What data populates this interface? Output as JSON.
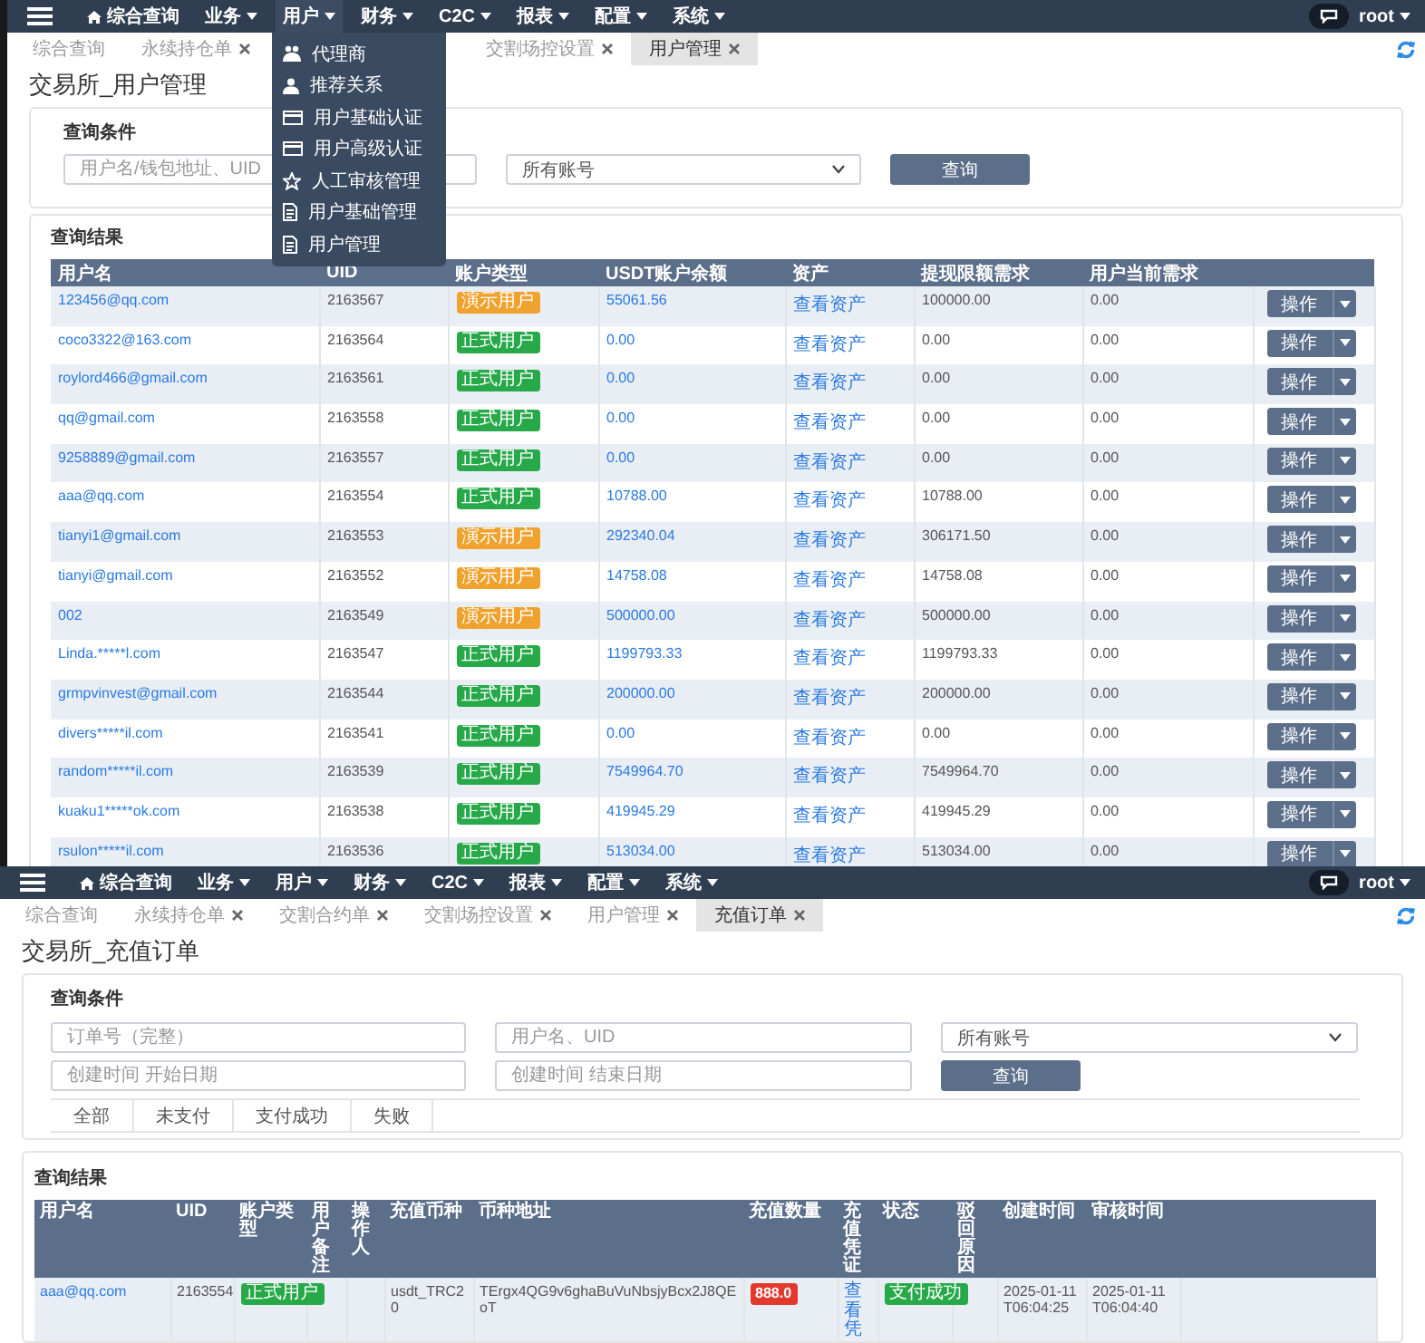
{
  "top_screen": {
    "navbar": {
      "menus": [
        {
          "kind": "home",
          "label": "综合查询"
        },
        {
          "kind": "dropdown",
          "label": "业务",
          "open": false
        },
        {
          "kind": "dropdown",
          "label": "用户",
          "open": true,
          "items": [
            "代理商",
            "推荐关系",
            "用户基础认证",
            "用户高级认证",
            "人工审核管理",
            "用户基础管理",
            "用户管理"
          ]
        },
        {
          "kind": "dropdown",
          "label": "财务",
          "open": false
        },
        {
          "kind": "dropdown",
          "label": "C2C",
          "open": false
        },
        {
          "kind": "dropdown",
          "label": "报表",
          "open": false
        },
        {
          "kind": "dropdown",
          "label": "配置",
          "open": false
        },
        {
          "kind": "dropdown",
          "label": "系统",
          "open": false
        }
      ],
      "user": "root"
    },
    "tabs": [
      {
        "label": "综合查询",
        "closable": false,
        "selected": false
      },
      {
        "label": "永续持仓单",
        "closable": true,
        "selected": false
      },
      {
        "label": "交割场控设置",
        "closable": true,
        "selected": false
      },
      {
        "label": "用户管理",
        "closable": true,
        "selected": true
      }
    ],
    "page_title": "交易所_用户管理",
    "query": {
      "title": "查询条件",
      "fields": [
        {
          "kind": "text",
          "placeholder": "用户名/钱包地址、UID"
        },
        {
          "kind": "select",
          "value": "所有账号"
        }
      ],
      "button": "查询"
    },
    "results": {
      "title": "查询结果",
      "columns": [
        "用户名",
        "UID",
        "账户类型",
        "USDT账户余额",
        "资产",
        "提现限额需求",
        "用户当前需求"
      ],
      "rows": [
        {
          "username": "123456@qq.com",
          "uid": "2163567",
          "account_type": {
            "label": "演示用户",
            "kind": "demo"
          },
          "balance": "55061.56",
          "assets": "查看资产",
          "withdraw_limit": "100000.00",
          "current": "0.00",
          "action": "操作"
        },
        {
          "username": "coco3322@163.com",
          "uid": "2163564",
          "account_type": {
            "label": "正式用户",
            "kind": "real"
          },
          "balance": "0.00",
          "assets": "查看资产",
          "withdraw_limit": "0.00",
          "current": "0.00",
          "action": "操作"
        },
        {
          "username": "roylord466@gmail.com",
          "uid": "2163561",
          "account_type": {
            "label": "正式用户",
            "kind": "real"
          },
          "balance": "0.00",
          "assets": "查看资产",
          "withdraw_limit": "0.00",
          "current": "0.00",
          "action": "操作"
        },
        {
          "username": "qq@gmail.com",
          "uid": "2163558",
          "account_type": {
            "label": "正式用户",
            "kind": "real"
          },
          "balance": "0.00",
          "assets": "查看资产",
          "withdraw_limit": "0.00",
          "current": "0.00",
          "action": "操作"
        },
        {
          "username": "9258889@gmail.com",
          "uid": "2163557",
          "account_type": {
            "label": "正式用户",
            "kind": "real"
          },
          "balance": "0.00",
          "assets": "查看资产",
          "withdraw_limit": "0.00",
          "current": "0.00",
          "action": "操作"
        },
        {
          "username": "aaa@qq.com",
          "uid": "2163554",
          "account_type": {
            "label": "正式用户",
            "kind": "real"
          },
          "balance": "10788.00",
          "assets": "查看资产",
          "withdraw_limit": "10788.00",
          "current": "0.00",
          "action": "操作"
        },
        {
          "username": "tianyi1@gmail.com",
          "uid": "2163553",
          "account_type": {
            "label": "演示用户",
            "kind": "demo"
          },
          "balance": "292340.04",
          "assets": "查看资产",
          "withdraw_limit": "306171.50",
          "current": "0.00",
          "action": "操作"
        },
        {
          "username": "tianyi@gmail.com",
          "uid": "2163552",
          "account_type": {
            "label": "演示用户",
            "kind": "demo"
          },
          "balance": "14758.08",
          "assets": "查看资产",
          "withdraw_limit": "14758.08",
          "current": "0.00",
          "action": "操作"
        },
        {
          "username": "002",
          "uid": "2163549",
          "account_type": {
            "label": "演示用户",
            "kind": "demo"
          },
          "balance": "500000.00",
          "assets": "查看资产",
          "withdraw_limit": "500000.00",
          "current": "0.00",
          "action": "操作"
        },
        {
          "username": "Linda.*****l.com",
          "uid": "2163547",
          "account_type": {
            "label": "正式用户",
            "kind": "real"
          },
          "balance": "1199793.33",
          "assets": "查看资产",
          "withdraw_limit": "1199793.33",
          "current": "0.00",
          "action": "操作"
        },
        {
          "username": "grmpvinvest@gmail.com",
          "uid": "2163544",
          "account_type": {
            "label": "正式用户",
            "kind": "real"
          },
          "balance": "200000.00",
          "assets": "查看资产",
          "withdraw_limit": "200000.00",
          "current": "0.00",
          "action": "操作"
        },
        {
          "username": "divers*****il.com",
          "uid": "2163541",
          "account_type": {
            "label": "正式用户",
            "kind": "real"
          },
          "balance": "0.00",
          "assets": "查看资产",
          "withdraw_limit": "0.00",
          "current": "0.00",
          "action": "操作"
        },
        {
          "username": "random*****il.com",
          "uid": "2163539",
          "account_type": {
            "label": "正式用户",
            "kind": "real"
          },
          "balance": "7549964.70",
          "assets": "查看资产",
          "withdraw_limit": "7549964.70",
          "current": "0.00",
          "action": "操作"
        },
        {
          "username": "kuaku1*****ok.com",
          "uid": "2163538",
          "account_type": {
            "label": "正式用户",
            "kind": "real"
          },
          "balance": "419945.29",
          "assets": "查看资产",
          "withdraw_limit": "419945.29",
          "current": "0.00",
          "action": "操作"
        },
        {
          "username": "rsulon*****il.com",
          "uid": "2163536",
          "account_type": {
            "label": "正式用户",
            "kind": "real"
          },
          "balance": "513034.00",
          "assets": "查看资产",
          "withdraw_limit": "513034.00",
          "current": "0.00",
          "action": "操作"
        }
      ]
    }
  },
  "bottom_screen": {
    "navbar": {
      "menus": [
        {
          "kind": "home",
          "label": "综合查询"
        },
        {
          "kind": "dropdown",
          "label": "业务",
          "open": false
        },
        {
          "kind": "dropdown",
          "label": "用户",
          "open": false
        },
        {
          "kind": "dropdown",
          "label": "财务",
          "open": false
        },
        {
          "kind": "dropdown",
          "label": "C2C",
          "open": false
        },
        {
          "kind": "dropdown",
          "label": "报表",
          "open": false
        },
        {
          "kind": "dropdown",
          "label": "配置",
          "open": false
        },
        {
          "kind": "dropdown",
          "label": "系统",
          "open": false
        }
      ],
      "user": "root"
    },
    "tabs": [
      {
        "label": "综合查询",
        "closable": false,
        "selected": false
      },
      {
        "label": "永续持仓单",
        "closable": true,
        "selected": false
      },
      {
        "label": "交割合约单",
        "closable": true,
        "selected": false
      },
      {
        "label": "交割场控设置",
        "closable": true,
        "selected": false
      },
      {
        "label": "用户管理",
        "closable": true,
        "selected": false
      },
      {
        "label": "充值订单",
        "closable": true,
        "selected": true
      }
    ],
    "page_title": "交易所_充值订单",
    "query": {
      "title": "查询条件",
      "fields": [
        {
          "kind": "text",
          "placeholder": "订单号（完整）"
        },
        {
          "kind": "text",
          "placeholder": "用户名、UID"
        },
        {
          "kind": "select",
          "value": "所有账号"
        },
        {
          "kind": "text",
          "placeholder": "创建时间 开始日期"
        },
        {
          "kind": "text",
          "placeholder": "创建时间 结束日期"
        }
      ],
      "button": "查询",
      "filters": [
        {
          "label": "全部",
          "selected": false
        },
        {
          "label": "未支付",
          "selected": false
        },
        {
          "label": "支付成功",
          "selected": false
        },
        {
          "label": "失败",
          "selected": false
        }
      ]
    },
    "results": {
      "title": "查询结果",
      "columns": [
        "用户名",
        "UID",
        "账户类型",
        "用户备注",
        "操作人",
        "充值币种",
        "币种地址",
        "充值数量",
        "充值凭证",
        "状态",
        "驳回原因",
        "创建时间",
        "审核时间"
      ],
      "rows": [
        {
          "username": "aaa@qq.com",
          "uid": "2163554",
          "account_type": {
            "label": "正式用户",
            "kind": "real"
          },
          "currency": "usdt_TRC20",
          "address": "TErgx4QG9v6ghaBuVuNbsjyBcx2J8QEoT",
          "amount": "888.0",
          "voucher": "查看凭",
          "status": {
            "label": "支付成功",
            "kind": "success"
          },
          "created": "2025-01-11T06:04:25",
          "reviewed": "2025-01-11T06:04:40"
        }
      ]
    }
  }
}
